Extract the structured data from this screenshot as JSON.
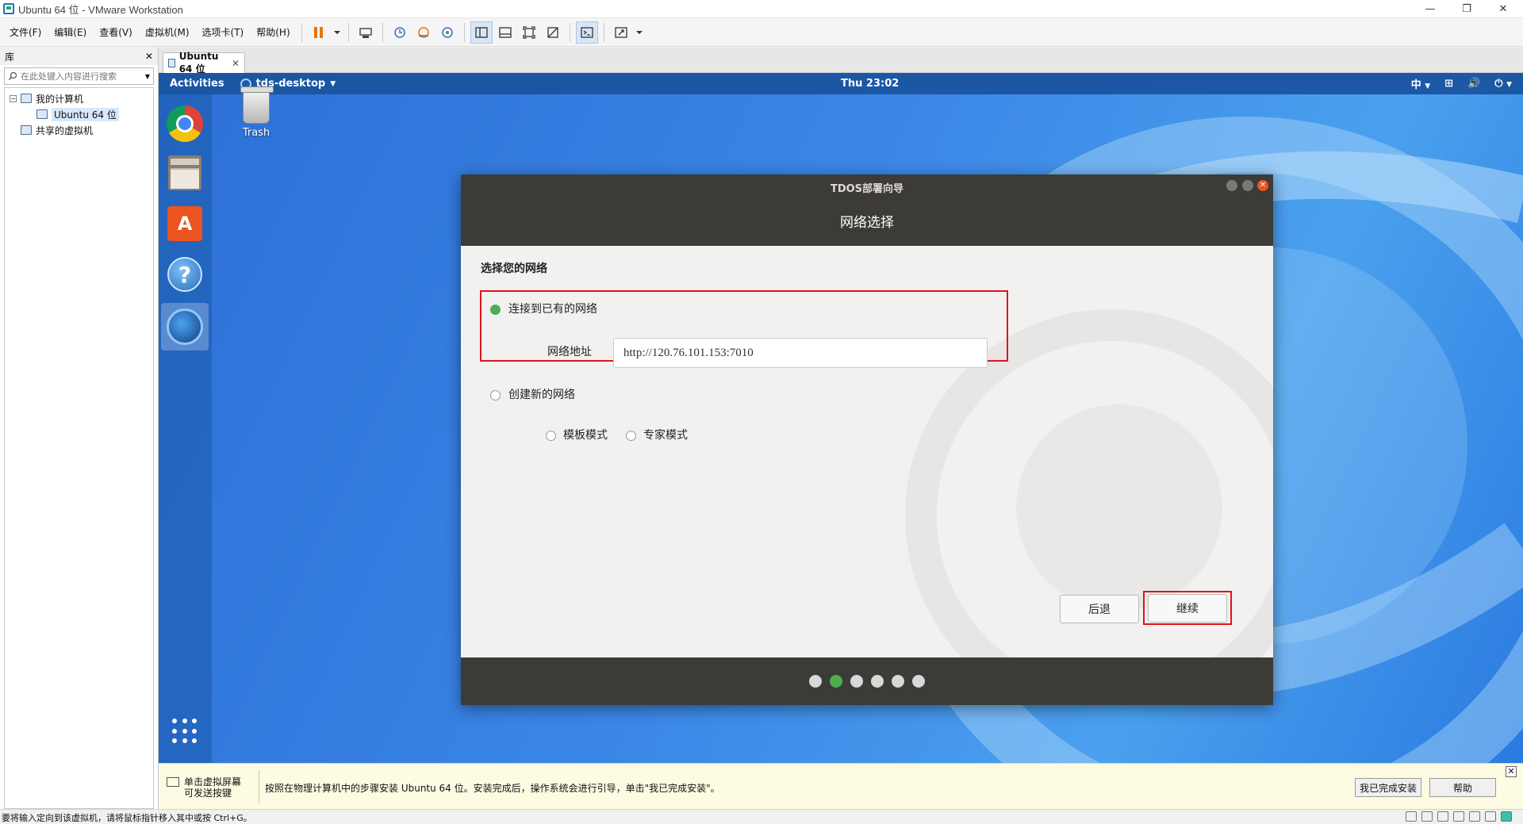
{
  "window": {
    "title": "Ubuntu 64 位 - VMware Workstation",
    "controls": [
      "minimize-icon",
      "restore-icon",
      "close-icon"
    ]
  },
  "menu": {
    "items": [
      "文件(F)",
      "编辑(E)",
      "查看(V)",
      "虚拟机(M)",
      "选项卡(T)",
      "帮助(H)"
    ]
  },
  "toolbar": {
    "icons": [
      "pause-icon",
      "dropdown-icon",
      "send-ctrl-alt-del-icon",
      "snapshot-icon",
      "revert-snapshot-icon",
      "snapshot-manager-icon",
      "library-view-icon",
      "thumbnail-view-icon",
      "fullscreen-icon",
      "unity-icon",
      "console-icon",
      "stretch-icon"
    ]
  },
  "library": {
    "title": "库",
    "close": "✕",
    "search_placeholder": "在此处键入内容进行搜索",
    "tree": {
      "my_computer": "我的计算机",
      "vm": "Ubuntu 64 位",
      "shared": "共享的虚拟机"
    }
  },
  "vm_tab": {
    "label": "Ubuntu 64 位"
  },
  "guest": {
    "topbar": {
      "activities": "Activities",
      "app_menu": "tds-desktop",
      "clock": "Thu 23:02",
      "input_method": "中"
    },
    "desktop": {
      "trash_label": "Trash"
    },
    "dock": [
      "chrome-icon",
      "files-icon",
      "software-center-icon",
      "help-icon",
      "tdos-icon",
      "show-apps-icon"
    ]
  },
  "dialog": {
    "window_title": "TDOS部署向导",
    "page_title": "网络选择",
    "section_title": "选择您的网络",
    "options": {
      "connect_existing": "连接到已有的网络",
      "network_address_label": "网络地址",
      "network_address_value": "http://120.76.101.153:7010",
      "create_new": "创建新的网络",
      "template_mode": "模板模式",
      "expert_mode": "专家模式"
    },
    "buttons": {
      "back": "后退",
      "continue": "继续"
    },
    "progress": {
      "total_steps": 6,
      "current_step": 2
    },
    "colors": {
      "highlight": "#e0141c",
      "selected": "#4caf50",
      "header": "#3c3b37"
    }
  },
  "hint": {
    "left": "单击虚拟屏幕\n可发送按键",
    "left_line1": "单击虚拟屏幕",
    "left_line2": "可发送按键",
    "text": "按照在物理计算机中的步骤安装 Ubuntu 64 位。安装完成后，操作系统会进行引导，单击\"我已完成安装\"。",
    "done_button": "我已完成安装",
    "help_button": "帮助"
  },
  "status": {
    "message": "要将输入定向到该虚拟机，请将鼠标指针移入其中或按 Ctrl+G。"
  }
}
